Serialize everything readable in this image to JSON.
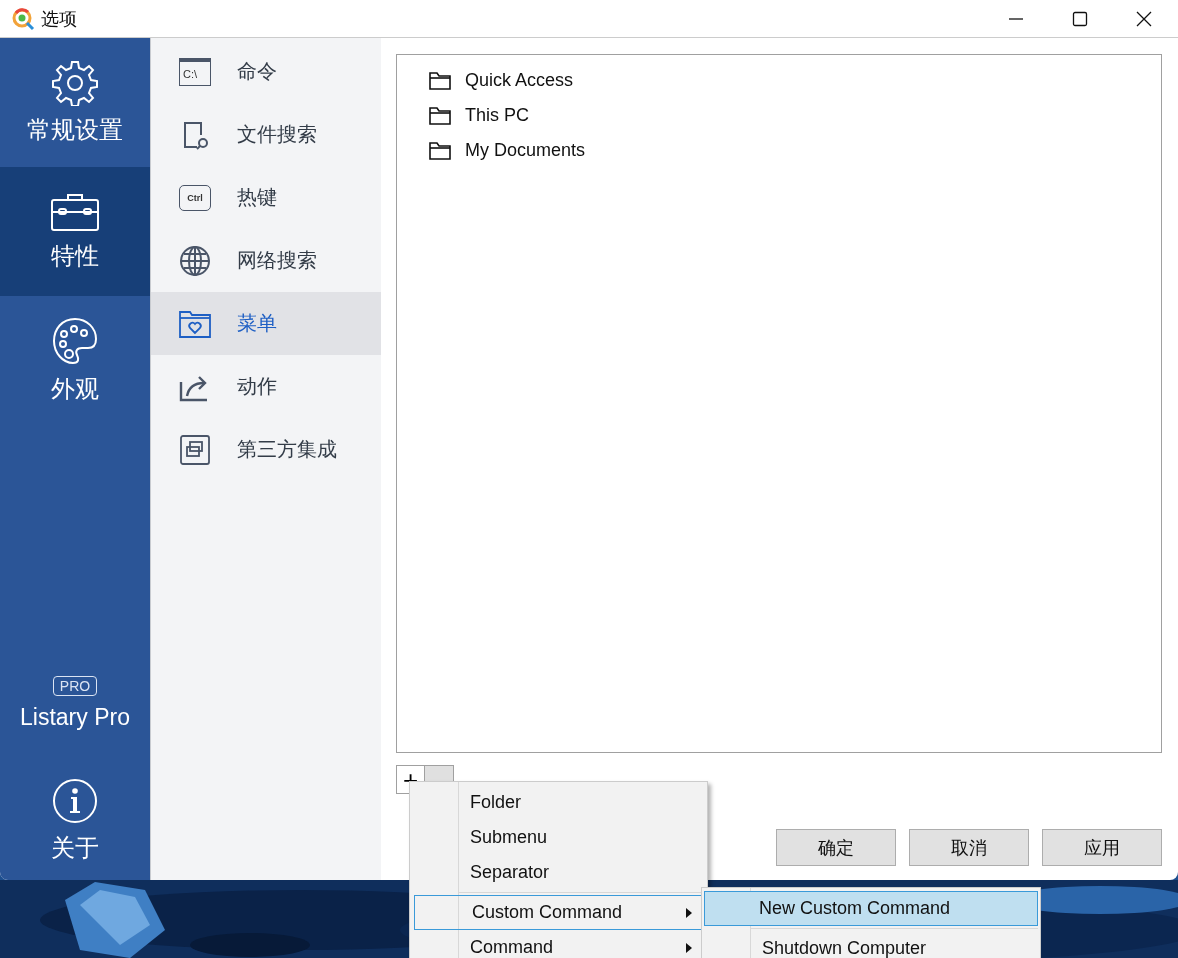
{
  "window": {
    "title": "选项"
  },
  "sidebar": {
    "items": [
      {
        "label": "常规设置",
        "kind": "gear",
        "selected": false
      },
      {
        "label": "特性",
        "kind": "toolbox",
        "selected": true
      },
      {
        "label": "外观",
        "kind": "palette",
        "selected": false
      }
    ],
    "bottom_items": [
      {
        "label": "Listary Pro",
        "kind": "pro",
        "badge": "PRO"
      },
      {
        "label": "关于",
        "kind": "info"
      }
    ]
  },
  "subnav": {
    "items": [
      {
        "label": "命令",
        "kind": "terminal",
        "icon_text": "C:\\",
        "selected": false
      },
      {
        "label": "文件搜索",
        "kind": "file-search",
        "selected": false
      },
      {
        "label": "热键",
        "kind": "key",
        "icon_text": "Ctrl",
        "selected": false
      },
      {
        "label": "网络搜索",
        "kind": "globe",
        "selected": false
      },
      {
        "label": "菜单",
        "kind": "folder-heart",
        "selected": true
      },
      {
        "label": "动作",
        "kind": "share",
        "selected": false
      },
      {
        "label": "第三方集成",
        "kind": "windows",
        "selected": false
      }
    ]
  },
  "menu_list": {
    "items": [
      "Quick Access",
      "This PC",
      "My Documents"
    ]
  },
  "add_button": "+",
  "dialog_buttons": [
    "确定",
    "取消",
    "应用"
  ],
  "context_menu": {
    "items": [
      {
        "kind": "item",
        "label": "Folder",
        "has_submenu": false,
        "selected": false
      },
      {
        "kind": "item",
        "label": "Submenu",
        "has_submenu": false,
        "selected": false
      },
      {
        "kind": "item",
        "label": "Separator",
        "has_submenu": false,
        "selected": false
      },
      {
        "kind": "separator"
      },
      {
        "kind": "item",
        "label": "Custom Command",
        "has_submenu": true,
        "selected": true
      },
      {
        "kind": "item",
        "label": "Command",
        "has_submenu": true,
        "selected": false
      }
    ]
  },
  "submenu": {
    "items": [
      {
        "kind": "item",
        "label": "New Custom Command",
        "selected": true
      },
      {
        "kind": "separator"
      },
      {
        "kind": "item",
        "label": "Shutdown Computer",
        "selected": false
      }
    ]
  }
}
